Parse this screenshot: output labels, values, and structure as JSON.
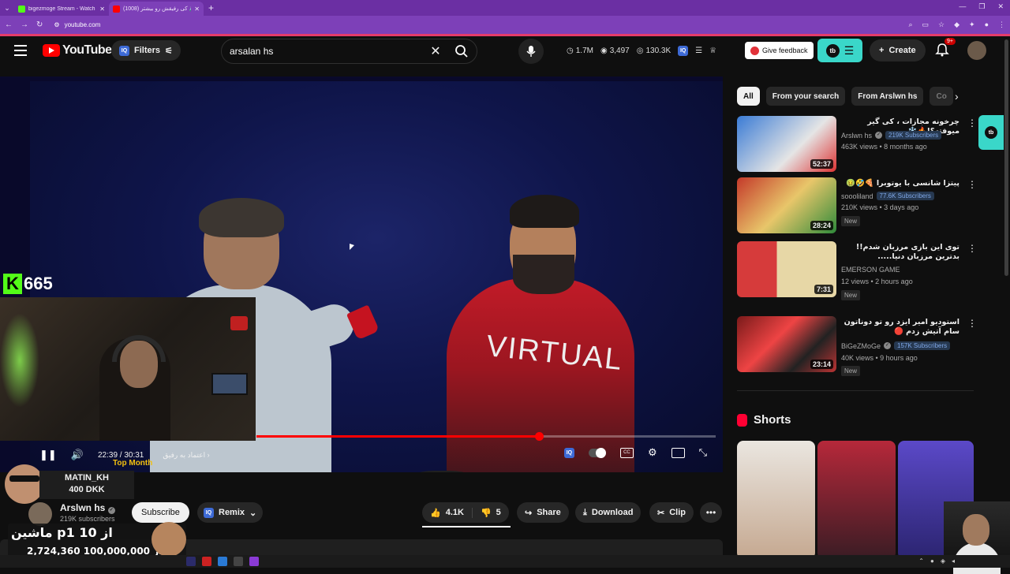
{
  "browser": {
    "tabs": [
      {
        "title": "bigezmoge Stream - Watch Live",
        "color": "#53fc18"
      },
      {
        "title": "(1008) کی رفیقش رو بیشتر 🔊",
        "color": "#ff0000"
      }
    ],
    "url": "youtube.com"
  },
  "header": {
    "logo_text": "YouTube",
    "filters_label": "Filters",
    "search_value": "arsalan hs",
    "stats": {
      "subs": "1.7M",
      "views": "3,497",
      "total": "130.3K"
    },
    "feedback_label": "Give feedback",
    "create_label": "Create",
    "notif_badge": "9+"
  },
  "player": {
    "time": "22:39 / 30:31",
    "chapter": "اعتماد به رفیق",
    "progress": 0.615,
    "buffered": 0.28,
    "sweater_text": "VIRTUAL"
  },
  "overlay": {
    "kick_count": "665",
    "top_month_label": "Top Month",
    "top_sub_name": "MATIN_KH",
    "top_sub_amount": "400 DKK",
    "goal_title": "ماشین p1 از 10",
    "goal_progress": "2,724,360 از 100,000,000 تومان"
  },
  "channel": {
    "name": "Arslwn hs",
    "subs": "219K subscribers",
    "subscribe_label": "Subscribe",
    "remix_label": "Remix",
    "likes": "4.1K",
    "dislikes": "5",
    "share_label": "Share",
    "download_label": "Download",
    "clip_label": "Clip"
  },
  "sidebar": {
    "chips": [
      "All",
      "From your search",
      "From Arslwn hs",
      "Co"
    ],
    "videos": [
      {
        "title": "چرخونه مجازات ، کی گیر میوفته؟!🔥❄️",
        "channel": "Arslwn hs",
        "subs": "219K Subscribers",
        "meta": "463K views • 8 months ago",
        "duration": "52:37",
        "new": false,
        "bg": "#3a7bd5"
      },
      {
        "title": "پیتزا شانسی با یوتوبرا 🍕🤣🤢",
        "channel": "soooliland",
        "subs": "77.6K Subscribers",
        "meta": "210K views • 3 days ago",
        "duration": "28:24",
        "new": true,
        "bg": "#c4392a"
      },
      {
        "title": "توی این بازی مرزبان شدم!! بدترین مرزبان دنیا.....",
        "channel": "EMERSON GAME",
        "subs": "",
        "meta": "12 views • 2 hours ago",
        "duration": "7:31",
        "new": true,
        "bg": "#d63b3b"
      },
      {
        "title": "استودیو امیر ایزد رو تو دوناتون سام آتیش زدم 🔴",
        "channel": "BiGeZMoGe",
        "subs": "157K Subscribers",
        "meta": "40K views • 9 hours ago",
        "duration": "23:14",
        "new": true,
        "bg": "#7a1a1a"
      }
    ],
    "new_label": "New",
    "shorts_title": "Shorts"
  }
}
